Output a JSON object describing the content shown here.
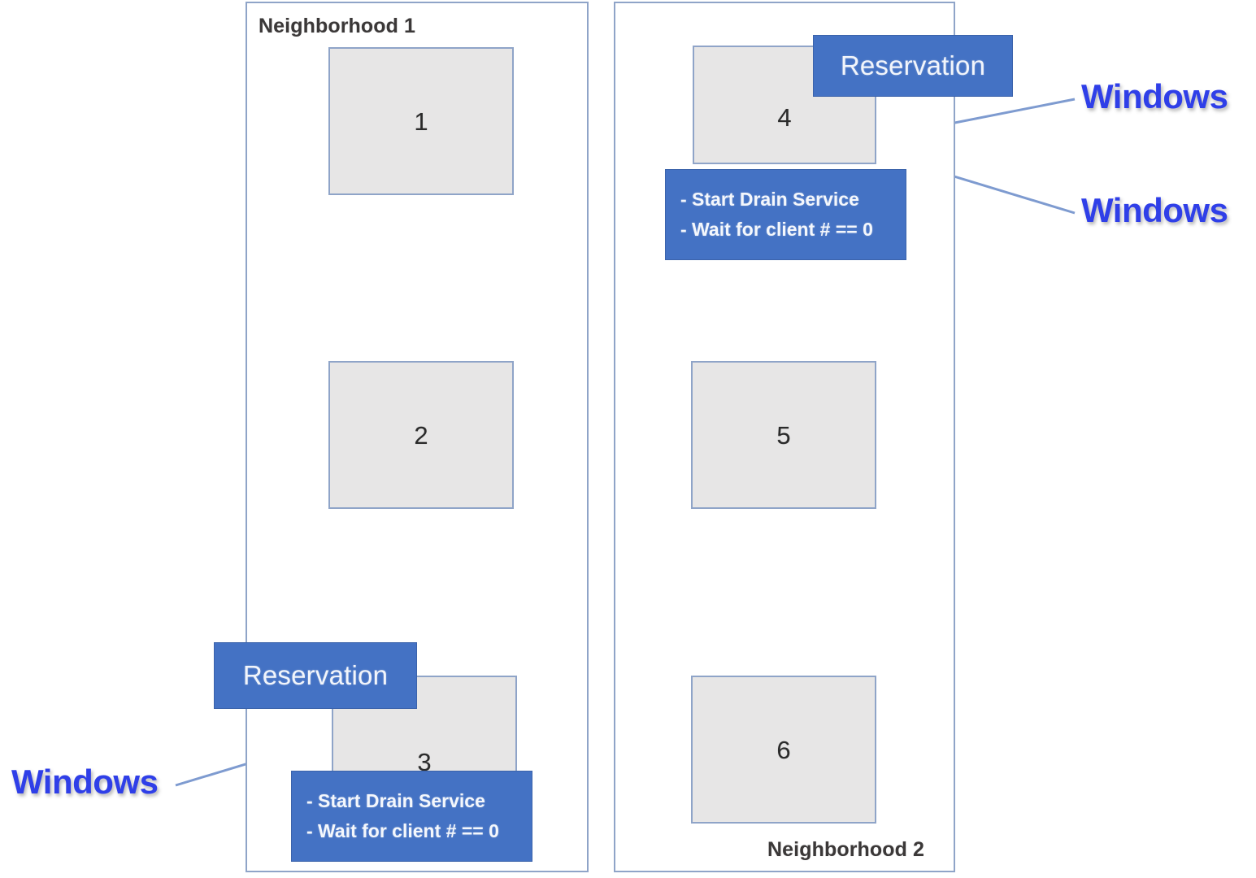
{
  "diagram": {
    "title": "Neighborhood Reservation Diagram",
    "colors": {
      "accent_blue": "#4472C4",
      "node_fill": "#E7E6E6",
      "node_border": "#8FA4C8",
      "connector": "#7E9BD0",
      "watermark_blue": "#2F3FE8",
      "label_text": "#3B3838",
      "background": "#FFFFFF"
    }
  },
  "neighborhoods": [
    {
      "id": "neighborhood-1",
      "label": "Neighborhood 1",
      "label_position": "top-left"
    },
    {
      "id": "neighborhood-2",
      "label": "Neighborhood 2",
      "label_position": "bottom-right"
    }
  ],
  "nodes": [
    {
      "id": "node-1",
      "label": "1",
      "neighborhood": "neighborhood-1"
    },
    {
      "id": "node-2",
      "label": "2",
      "neighborhood": "neighborhood-1"
    },
    {
      "id": "node-3",
      "label": "3",
      "neighborhood": "neighborhood-1"
    },
    {
      "id": "node-4",
      "label": "4",
      "neighborhood": "neighborhood-2"
    },
    {
      "id": "node-5",
      "label": "5",
      "neighborhood": "neighborhood-2"
    },
    {
      "id": "node-6",
      "label": "6",
      "neighborhood": "neighborhood-2"
    }
  ],
  "callouts": [
    {
      "id": "reservation-node-4",
      "title": "Reservation",
      "attached_to": "node-4"
    },
    {
      "id": "reservation-node-3",
      "title": "Reservation",
      "attached_to": "node-3"
    }
  ],
  "action_lists": [
    {
      "id": "actions-node-4",
      "attached_to": "node-4",
      "items": [
        "- Start Drain Service",
        "- Wait for client # == 0"
      ]
    },
    {
      "id": "actions-node-3",
      "attached_to": "node-3",
      "items": [
        "- Start Drain Service",
        "- Wait for client # == 0"
      ]
    }
  ],
  "watermarks": [
    {
      "id": "watermark-top-right",
      "label": "Windows"
    },
    {
      "id": "watermark-mid-right",
      "label": "Windows"
    },
    {
      "id": "watermark-bottom-left",
      "label": "Windows"
    }
  ]
}
